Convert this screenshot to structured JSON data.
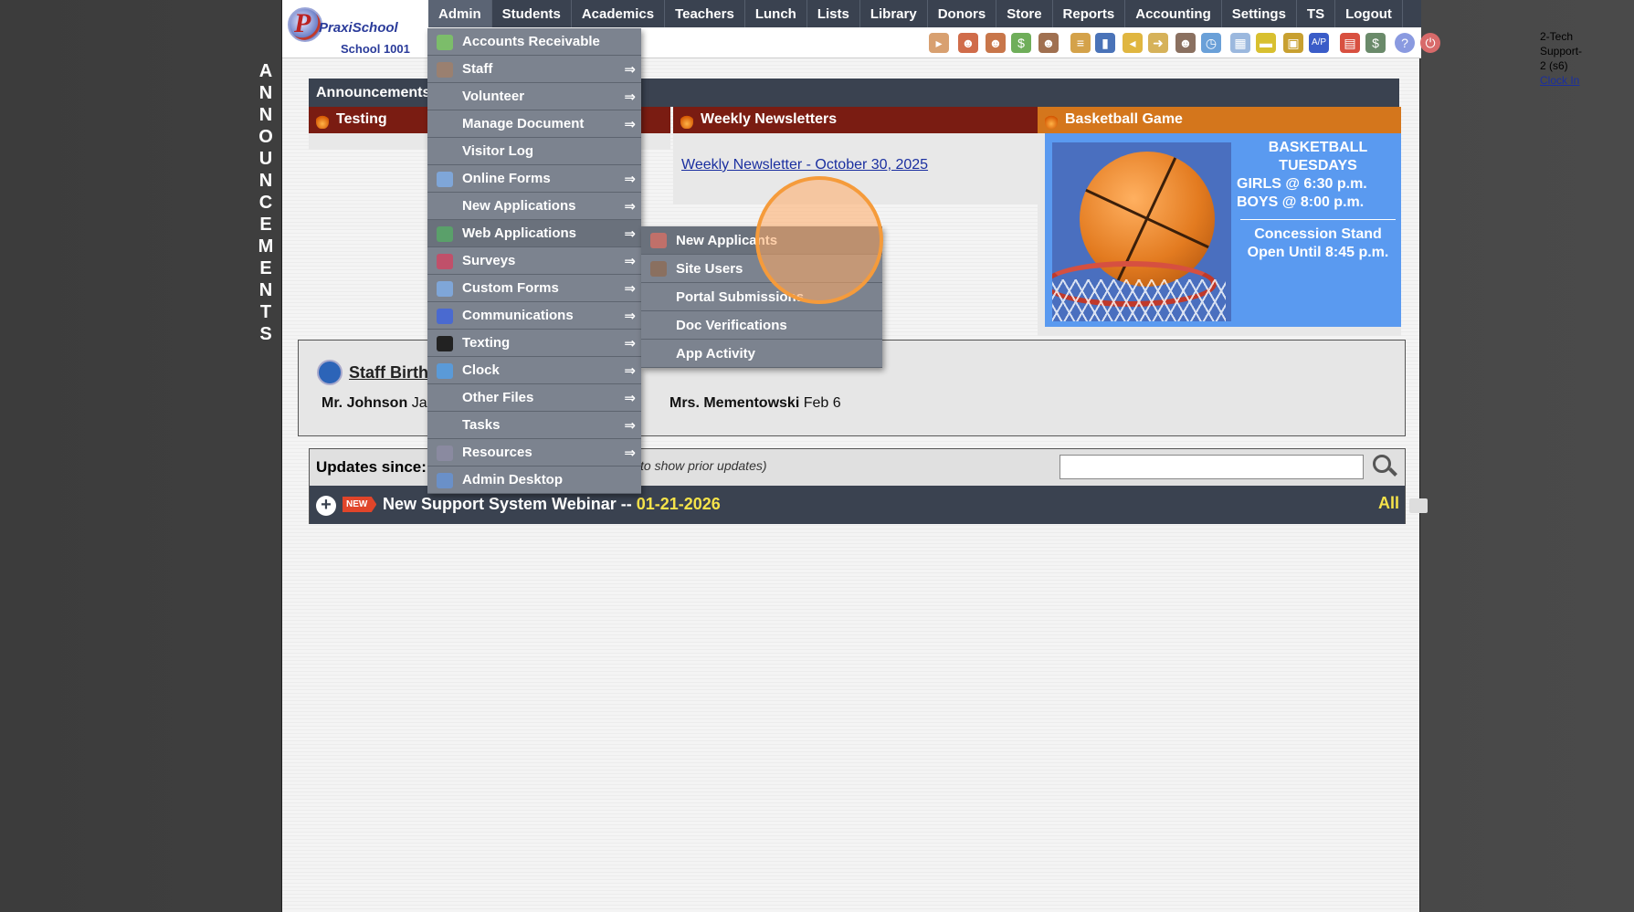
{
  "side_letters": [
    "A",
    "N",
    "N",
    "O",
    "U",
    "N",
    "C",
    "E",
    "M",
    "E",
    "N",
    "T",
    "S"
  ],
  "logo": {
    "brand": "PraxiSchool",
    "school": "School 1001"
  },
  "nav": [
    "Admin",
    "Students",
    "Academics",
    "Teachers",
    "Lunch",
    "Lists",
    "Library",
    "Donors",
    "Store",
    "Reports",
    "Accounting",
    "Settings",
    "TS",
    "Logout"
  ],
  "user": {
    "name": "2-Tech Support-2 (s6)",
    "clock_in": "Clock In"
  },
  "announcements": {
    "bar_title": "Announcements",
    "cards": [
      {
        "title": "Testing"
      },
      {
        "title": "Weekly Newsletters",
        "link": "Weekly Newsletter - October 30, 2025"
      },
      {
        "title": "Basketball Game"
      }
    ],
    "basketball": {
      "line1": "BASKETBALL",
      "line2": "TUESDAYS",
      "line3": "GIRLS @ 6:30 p.m.",
      "line4": "BOYS  @ 8:00 p.m.",
      "line5": "Concession Stand",
      "line6": "Open Until 8:45 p.m."
    }
  },
  "birthdays": {
    "title": "Staff Birthdays",
    "entries": [
      {
        "name": "Mr. Johnson",
        "date": "Jan"
      },
      {
        "name": "Mrs. Mementowski",
        "date": "Feb 6"
      }
    ]
  },
  "updates": {
    "label": "Updates since:",
    "hint": "to show prior updates)",
    "search_value": "",
    "badge": "NEW",
    "row_title": "New Support System Webinar -- ",
    "row_date": "01-21-2026",
    "all_label": "All"
  },
  "admin_menu": [
    {
      "label": "Accounts Receivable",
      "icon": "money-icon",
      "arrow": ""
    },
    {
      "label": "Staff",
      "icon": "staff-icon",
      "arrow": "⇒"
    },
    {
      "label": "Volunteer",
      "icon": "",
      "arrow": "⇒"
    },
    {
      "label": "Manage Document",
      "icon": "",
      "arrow": "⇒"
    },
    {
      "label": "Visitor Log",
      "icon": "",
      "arrow": ""
    },
    {
      "label": "Online Forms",
      "icon": "form-icon",
      "arrow": "⇒"
    },
    {
      "label": "New Applications",
      "icon": "",
      "arrow": "⇒"
    },
    {
      "label": "Web Applications",
      "icon": "globe-icon",
      "arrow": "⇒"
    },
    {
      "label": "Surveys",
      "icon": "survey-icon",
      "arrow": "⇒"
    },
    {
      "label": "Custom Forms",
      "icon": "form-icon",
      "arrow": "⇒"
    },
    {
      "label": "Communications",
      "icon": "at-icon",
      "arrow": "⇒"
    },
    {
      "label": "Texting",
      "icon": "phone-icon",
      "arrow": "⇒"
    },
    {
      "label": "Clock",
      "icon": "clock-icon",
      "arrow": "⇒"
    },
    {
      "label": "Other Files",
      "icon": "",
      "arrow": "⇒"
    },
    {
      "label": "Tasks",
      "icon": "",
      "arrow": "⇒"
    },
    {
      "label": "Resources",
      "icon": "book-icon",
      "arrow": "⇒"
    },
    {
      "label": "Admin Desktop",
      "icon": "desktop-icon",
      "arrow": ""
    }
  ],
  "sub_menu": [
    {
      "label": "New Applicants",
      "icon": "applicant-icon"
    },
    {
      "label": "Site Users",
      "icon": "user-icon"
    },
    {
      "label": "Portal Submissions",
      "icon": ""
    },
    {
      "label": "Doc Verifications",
      "icon": ""
    },
    {
      "label": "App Activity",
      "icon": ""
    }
  ]
}
